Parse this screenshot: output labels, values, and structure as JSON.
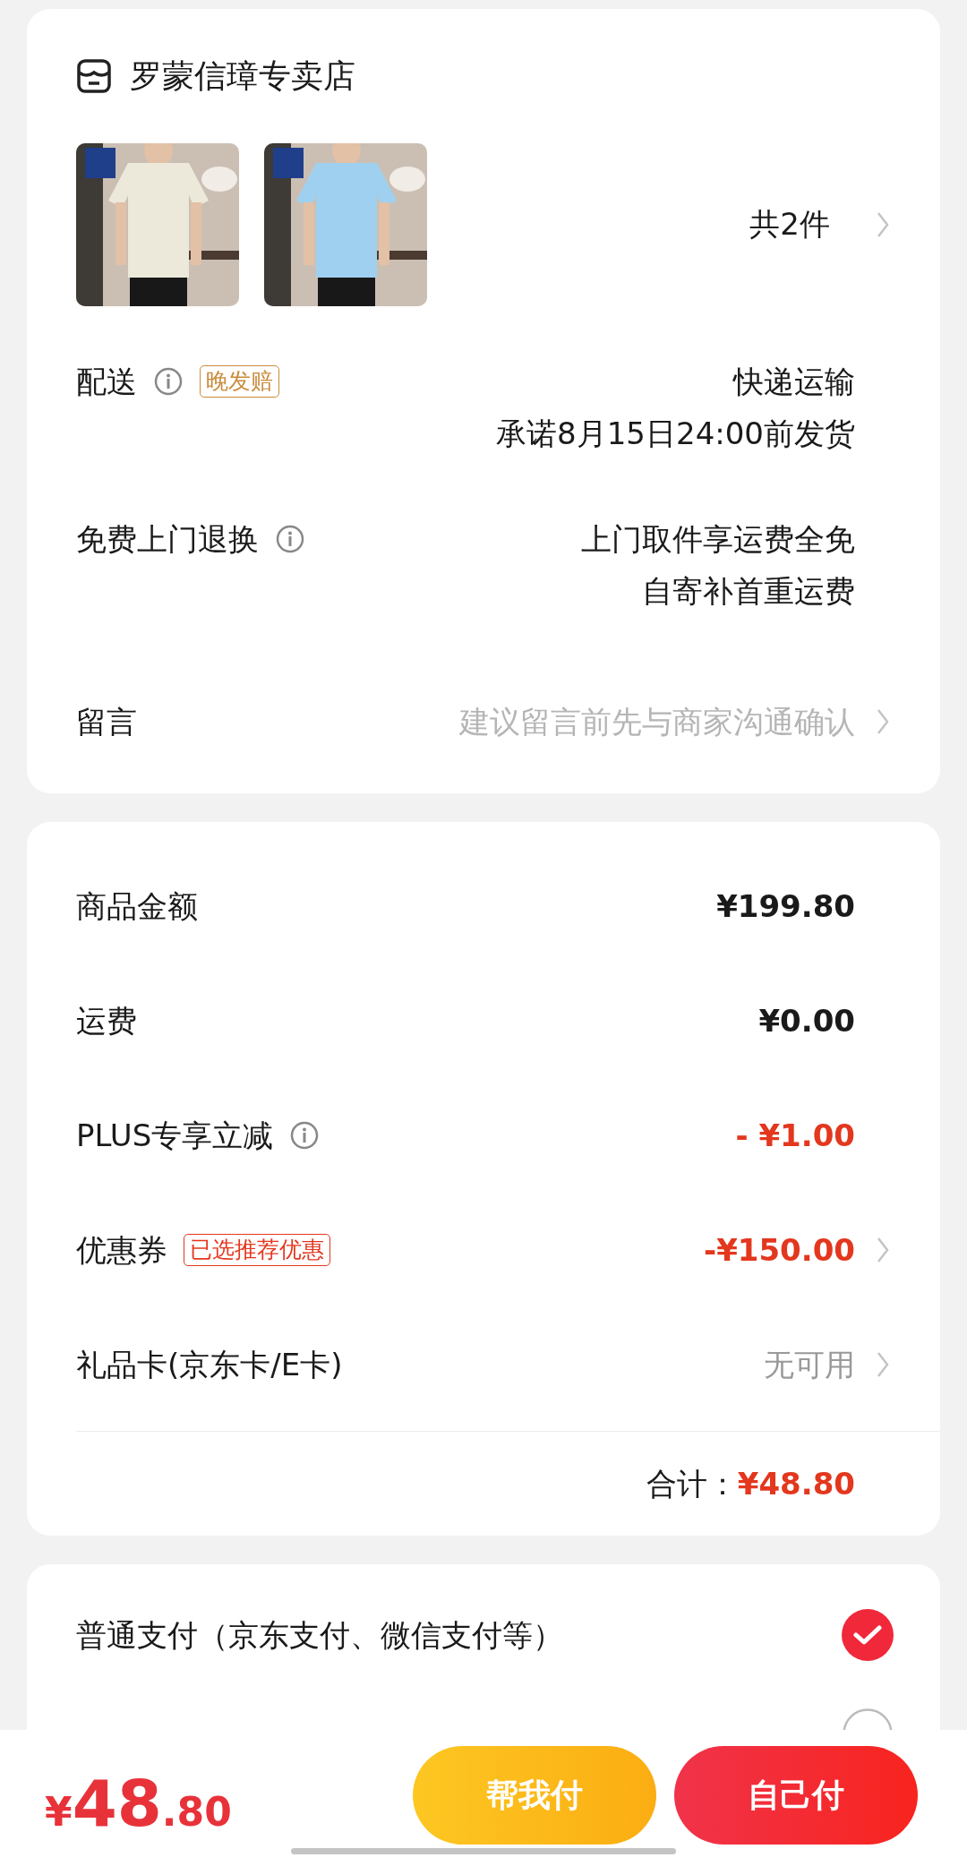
{
  "store": {
    "name": "罗蒙信璋专卖店"
  },
  "products": {
    "count": "共2件"
  },
  "details": [
    {
      "label": "配送",
      "info_icon": true,
      "badge": "晚发赔",
      "values": [
        "快递运输",
        "承诺8月15日24:00前发货"
      ]
    },
    {
      "label": "免费上门退换",
      "info_icon": true,
      "values": [
        "上门取件享运费全免",
        "自寄补首重运费"
      ]
    },
    {
      "label": "留言",
      "placeholder": "建议留言前先与商家沟通确认",
      "chevron": true
    }
  ],
  "summary": [
    {
      "label": "商品金额",
      "value": "¥199.80",
      "discount": false,
      "unavailable": false
    },
    {
      "label": "运费",
      "value": "¥0.00",
      "discount": false,
      "unavailable": false
    },
    {
      "label": "PLUS专享立减",
      "value": "- ¥1.00",
      "discount": true,
      "unavailable": false,
      "info_icon": true
    },
    {
      "label": "优惠券",
      "badge": "已选推荐优惠",
      "value": "-¥150.00",
      "discount": true,
      "unavailable": false,
      "chevron": true
    },
    {
      "label": "礼品卡(京东卡/E卡)",
      "value": "无可用",
      "discount": false,
      "unavailable": true,
      "chevron": true
    }
  ],
  "total": {
    "label": "合计：",
    "value": "¥48.80"
  },
  "payment": [
    {
      "label": "普通支付（京东支付、微信支付等）",
      "selected": true
    },
    {
      "selected": false
    }
  ],
  "bottom_bar": {
    "price": {
      "currency": "¥",
      "integer": "48",
      "decimal": ".80"
    },
    "buttons": [
      {
        "label": "帮我付",
        "kind": "friend"
      },
      {
        "label": "自己付",
        "kind": "self"
      }
    ]
  }
}
